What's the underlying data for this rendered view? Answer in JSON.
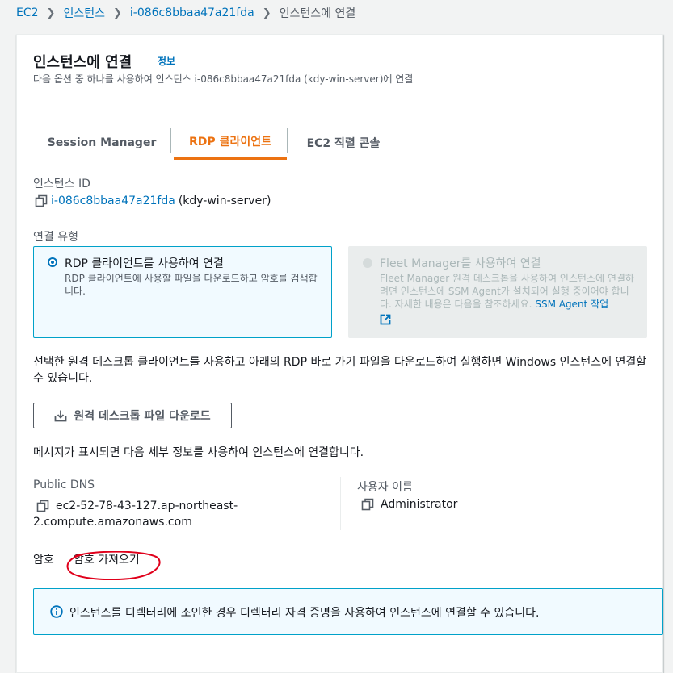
{
  "breadcrumb": {
    "items": [
      "EC2",
      "인스턴스",
      "i-086c8bbaa47a21fda",
      "인스턴스에 연결"
    ]
  },
  "header": {
    "title": "인스턴스에 연결",
    "info_link": "정보",
    "description": "다음 옵션 중 하나를 사용하여 인스턴스 i-086c8bbaa47a21fda (kdy-win-server)에 연결"
  },
  "tabs": [
    {
      "label": "Session Manager",
      "active": false
    },
    {
      "label": "RDP 클라이언트",
      "active": true
    },
    {
      "label": "EC2 직렬 콘솔",
      "active": false
    }
  ],
  "instance": {
    "label": "인스턴스 ID",
    "id": "i-086c8bbaa47a21fda",
    "name": "(kdy-win-server)"
  },
  "connection_type": {
    "label": "연결 유형",
    "options": [
      {
        "title": "RDP 클라이언트를 사용하여 연결",
        "description": "RDP 클라이언트에 사용할 파일을 다운로드하고 암호를 검색합니다.",
        "selected": true,
        "disabled": false
      },
      {
        "title": "Fleet Manager를 사용하여 연결",
        "description": "Fleet Manager 원격 데스크톱을 사용하여 인스턴스에 연결하려면 인스턴스에 SSM Agent가 설치되어 실행 중이어야 합니다. 자세한 내용은 다음을 참조하세요.",
        "link_text": "SSM Agent 작업",
        "selected": false,
        "disabled": true
      }
    ]
  },
  "instructions": "선택한 원격 데스크톱 클라이언트를 사용하고 아래의 RDP 바로 가기 파일을 다운로드하여 실행하면 Windows 인스턴스에 연결할 수 있습니다.",
  "download_button": "원격 데스크톱 파일 다운로드",
  "prompt_text": "메시지가 표시되면 다음 세부 정보를 사용하여 인스턴스에 연결합니다.",
  "details": {
    "public_dns_label": "Public DNS",
    "public_dns_line1": "ec2-52-78-43-127.ap-northeast-",
    "public_dns_line2": "2.compute.amazonaws.com",
    "username_label": "사용자 이름",
    "username": "Administrator",
    "password_label": "암호",
    "get_password": "암호 가져오기"
  },
  "info_alert": "인스턴스를 디렉터리에 조인한 경우 디렉터리 자격 증명을 사용하여 인스턴스에 연결할 수 있습니다.",
  "colors": {
    "link": "#0073bb",
    "accent": "#ec7211",
    "selected_border": "#00a1c9",
    "annotation": "#e0001b"
  }
}
